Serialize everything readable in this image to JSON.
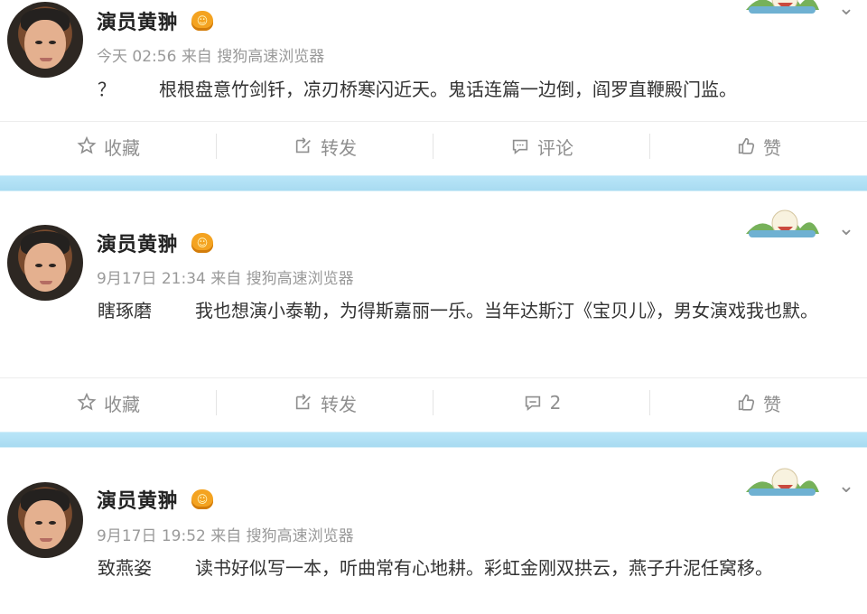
{
  "posts": [
    {
      "author": "演员黄翀",
      "badge": "vip",
      "time": "今天 02:56",
      "source": "来自 搜狗高速浏览器",
      "prefix": "？",
      "text": "根根盘意竹剑钎，凉刃桥寒闪近天。鬼话连篇一边倒，阎罗直鞭殿门监。",
      "actions": {
        "favorite": "收藏",
        "repost": "转发",
        "comment": "评论",
        "like": "赞"
      }
    },
    {
      "author": "演员黄翀",
      "badge": "vip",
      "time": "9月17日 21:34",
      "source": "来自 搜狗高速浏览器",
      "prefix": "瞎琢磨",
      "text": "我也想演小泰勒，为得斯嘉丽一乐。当年达斯汀《宝贝儿》，男女演戏我也默。",
      "actions": {
        "favorite": "收藏",
        "repost": "转发",
        "comment": "2",
        "like": "赞"
      }
    },
    {
      "author": "演员黄翀",
      "badge": "vip",
      "time": "9月17日 19:52",
      "source": "来自 搜狗高速浏览器",
      "prefix": "致燕姿",
      "text": "读书好似写一本，听曲常有心地耕。彩虹金刚双拱云，燕子升泥任窝移。"
    }
  ],
  "colors": {
    "separator": "#aee0f5",
    "meta": "#9a9a9a",
    "action": "#8f8f8f"
  }
}
